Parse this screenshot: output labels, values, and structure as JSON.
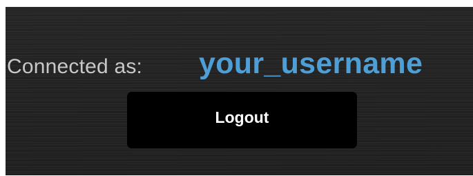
{
  "session": {
    "connected_label": "Connected as:",
    "username": "your_username"
  },
  "actions": {
    "logout_label": "Logout"
  },
  "colors": {
    "panel_background": "#232323",
    "label_text": "#c8c8c8",
    "username_accent": "#4e9fd6",
    "button_background": "#000000",
    "button_text": "#ffffff"
  }
}
